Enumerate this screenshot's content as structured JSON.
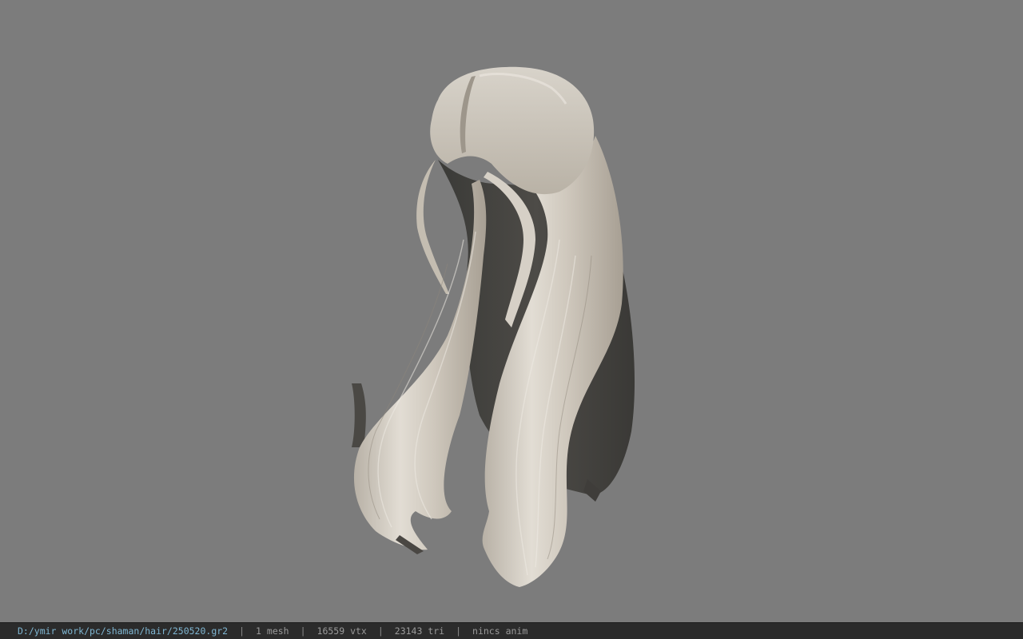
{
  "viewport": {
    "background": "#7c7c7c",
    "model": "hair-mesh"
  },
  "status_bar": {
    "file_path": "D:/ymir work/pc/shaman/hair/250520.gr2",
    "separator": "|",
    "mesh_count": "1 mesh",
    "vertex_count": "16559 vtx",
    "triangle_count": "23143 tri",
    "anim_label": "nincs anim",
    "colors": {
      "background": "#2b2b2b",
      "path": "#7fb6d2",
      "text": "#9a9a9a"
    }
  }
}
